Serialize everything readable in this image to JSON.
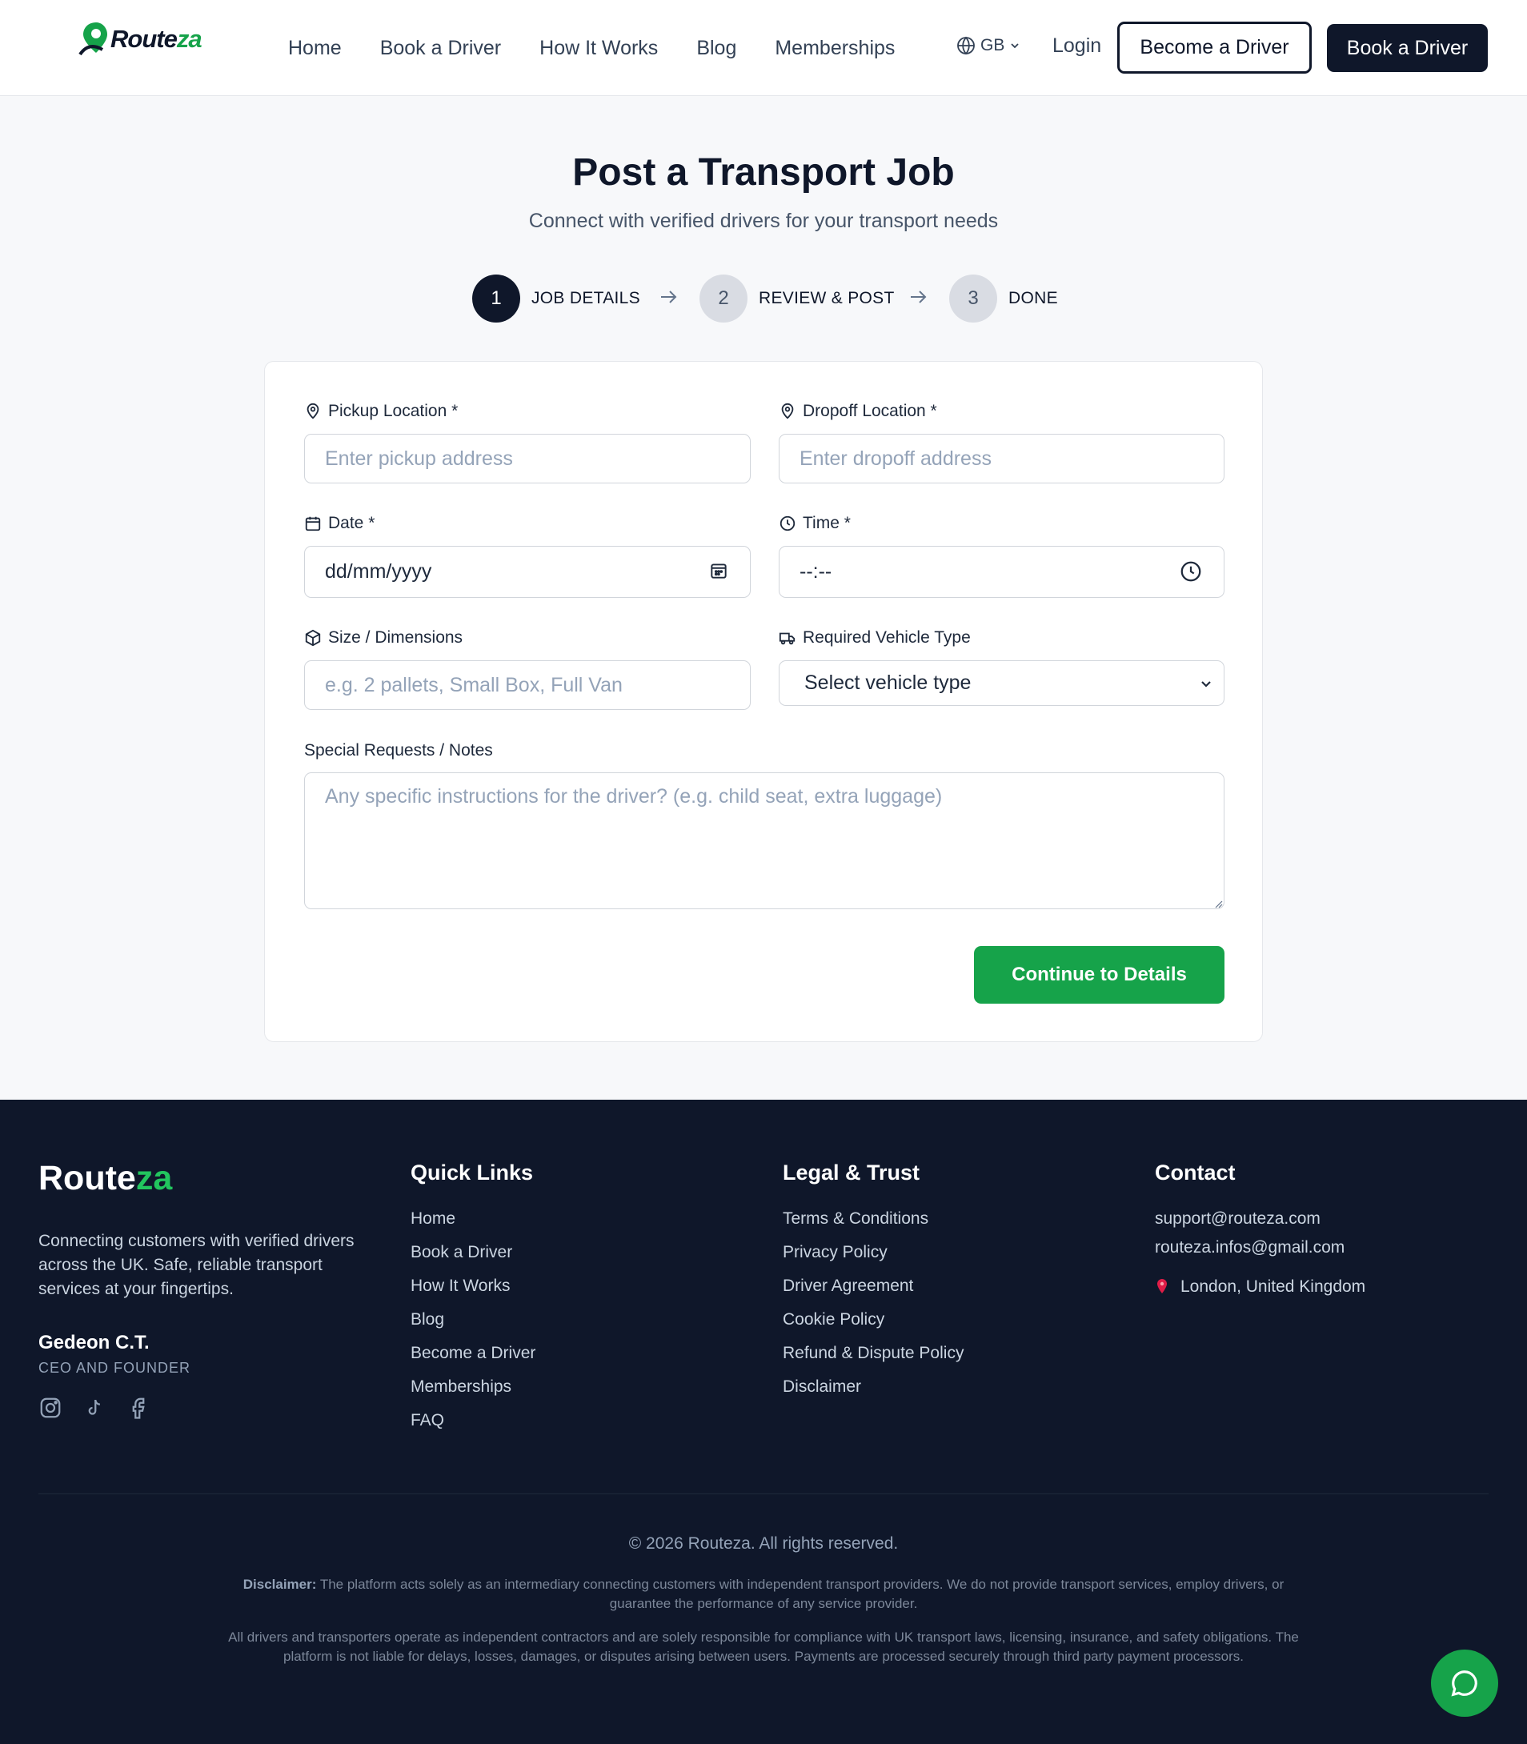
{
  "brand": {
    "logo_part1": "Route",
    "logo_part2": "za",
    "accent": "#16a34a"
  },
  "nav": {
    "items": [
      "Home",
      "Book a Driver",
      "How It Works",
      "Blog",
      "Memberships"
    ],
    "lang": "GB",
    "login": "Login",
    "become_driver": "Become a Driver",
    "book_driver": "Book a Driver"
  },
  "page": {
    "title": "Post a Transport Job",
    "subtitle": "Connect with verified drivers for your transport needs"
  },
  "steps": [
    {
      "num": "1",
      "label": "JOB DETAILS"
    },
    {
      "num": "2",
      "label": "REVIEW & POST"
    },
    {
      "num": "3",
      "label": "DONE"
    }
  ],
  "form": {
    "pickup_label": "Pickup Location *",
    "pickup_placeholder": "Enter pickup address",
    "dropoff_label": "Dropoff Location *",
    "dropoff_placeholder": "Enter dropoff address",
    "date_label": "Date *",
    "date_value": "dd/mm/yyyy",
    "time_label": "Time *",
    "time_value": "--:--",
    "size_label": "Size / Dimensions",
    "size_placeholder": "e.g. 2 pallets, Small Box, Full Van",
    "vehicle_label": "Required Vehicle Type",
    "vehicle_value": "Select vehicle type",
    "notes_label": "Special Requests / Notes",
    "notes_placeholder": "Any specific instructions for the driver? (e.g. child seat, extra luggage)",
    "submit": "Continue to Details"
  },
  "footer": {
    "logo_part1": "Route",
    "logo_part2": "za",
    "description": "Connecting customers with verified drivers across the UK. Safe, reliable transport services at your fingertips.",
    "founder_name": "Gedeon C.T.",
    "founder_role": "CEO AND FOUNDER",
    "quick_links_title": "Quick Links",
    "quick_links": [
      "Home",
      "Book a Driver",
      "How It Works",
      "Blog",
      "Become a Driver",
      "Memberships",
      "FAQ"
    ],
    "legal_title": "Legal & Trust",
    "legal_links": [
      "Terms & Conditions",
      "Privacy Policy",
      "Driver Agreement",
      "Cookie Policy",
      "Refund & Dispute Policy",
      "Disclaimer"
    ],
    "contact_title": "Contact",
    "email1": "support@routeza.com",
    "email2": "routeza.infos@gmail.com",
    "location": "London, United Kingdom",
    "copyright": "© 2026 Routeza. All rights reserved.",
    "disclaimer_label": "Disclaimer:",
    "disclaimer_text": " The platform acts solely as an intermediary connecting customers with independent transport providers. We do not provide transport services, employ drivers, or guarantee the performance of any service provider.",
    "disclaimer2": "All drivers and transporters operate as independent contractors and are solely responsible for compliance with UK transport laws, licensing, insurance, and safety obligations. The platform is not liable for delays, losses, damages, or disputes arising between users. Payments are processed securely through third party payment processors."
  }
}
